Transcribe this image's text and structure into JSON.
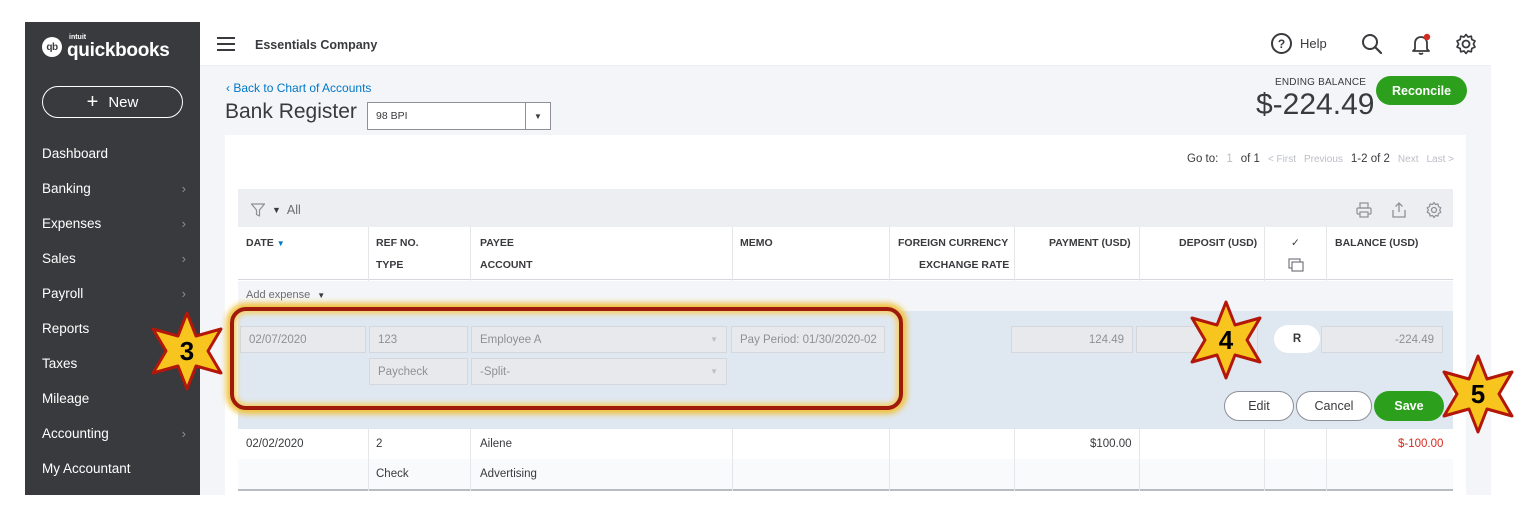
{
  "sidebar": {
    "logo_badge": "qb",
    "logo_intuit": "intuit",
    "logo_name": "quickbooks",
    "new_label": "New",
    "items": [
      {
        "label": "Dashboard",
        "chevron": false
      },
      {
        "label": "Banking",
        "chevron": true
      },
      {
        "label": "Expenses",
        "chevron": true
      },
      {
        "label": "Sales",
        "chevron": true
      },
      {
        "label": "Payroll",
        "chevron": true
      },
      {
        "label": "Reports",
        "chevron": false
      },
      {
        "label": "Taxes",
        "chevron": false
      },
      {
        "label": "Mileage",
        "chevron": false
      },
      {
        "label": "Accounting",
        "chevron": true
      },
      {
        "label": "My Accountant",
        "chevron": false
      }
    ]
  },
  "topbar": {
    "company": "Essentials Company",
    "help_label": "Help",
    "help_symbol": "?",
    "icons": [
      "search-icon",
      "notification-bell-icon",
      "settings-gear-icon"
    ]
  },
  "header": {
    "back_link": "Back to Chart of Accounts",
    "title": "Bank Register",
    "account_select": "98 BPI",
    "ending_balance_label": "ENDING BALANCE",
    "ending_balance": "$-224.49",
    "reconcile_label": "Reconcile"
  },
  "pager": {
    "goto_label": "Go to:",
    "page_current": "1",
    "page_of": "of 1",
    "first": "< First",
    "previous": "Previous",
    "range": "1-2 of 2",
    "next": "Next",
    "last": "Last >"
  },
  "filter": {
    "label": "All"
  },
  "columns": {
    "date": "DATE",
    "ref_no": "REF NO.",
    "type": "TYPE",
    "payee": "PAYEE",
    "account": "ACCOUNT",
    "memo": "MEMO",
    "foreign_currency": "FOREIGN CURRENCY",
    "exchange_rate": "EXCHANGE RATE",
    "payment": "PAYMENT (USD)",
    "deposit": "DEPOSIT (USD)",
    "check_mark": "✓",
    "balance": "BALANCE (USD)"
  },
  "add_expense": "Add expense",
  "edit_row": {
    "date": "02/07/2020",
    "ref_no": "123",
    "type": "Paycheck",
    "payee": "Employee A",
    "account": "-Split-",
    "memo": "Pay Period: 01/30/2020-02",
    "payment": "124.49",
    "deposit": "",
    "reconcile_status": "R",
    "balance": "-224.49",
    "edit_label": "Edit",
    "cancel_label": "Cancel",
    "save_label": "Save"
  },
  "rows": [
    {
      "date": "02/02/2020",
      "ref_no": "2",
      "type": "Check",
      "payee": "Ailene",
      "account": "Advertising",
      "payment": "$100.00",
      "balance": "$-100.00"
    }
  ],
  "annotations": {
    "step3": "3",
    "step4": "4",
    "step5": "5",
    "star_fill": "#f7c51e",
    "star_outline": "#b3170a"
  },
  "colors": {
    "sidebar_bg": "#393a3d",
    "brand_green": "#2ca01c",
    "link_blue": "#0077c5",
    "negative_red": "#d52b1e"
  }
}
